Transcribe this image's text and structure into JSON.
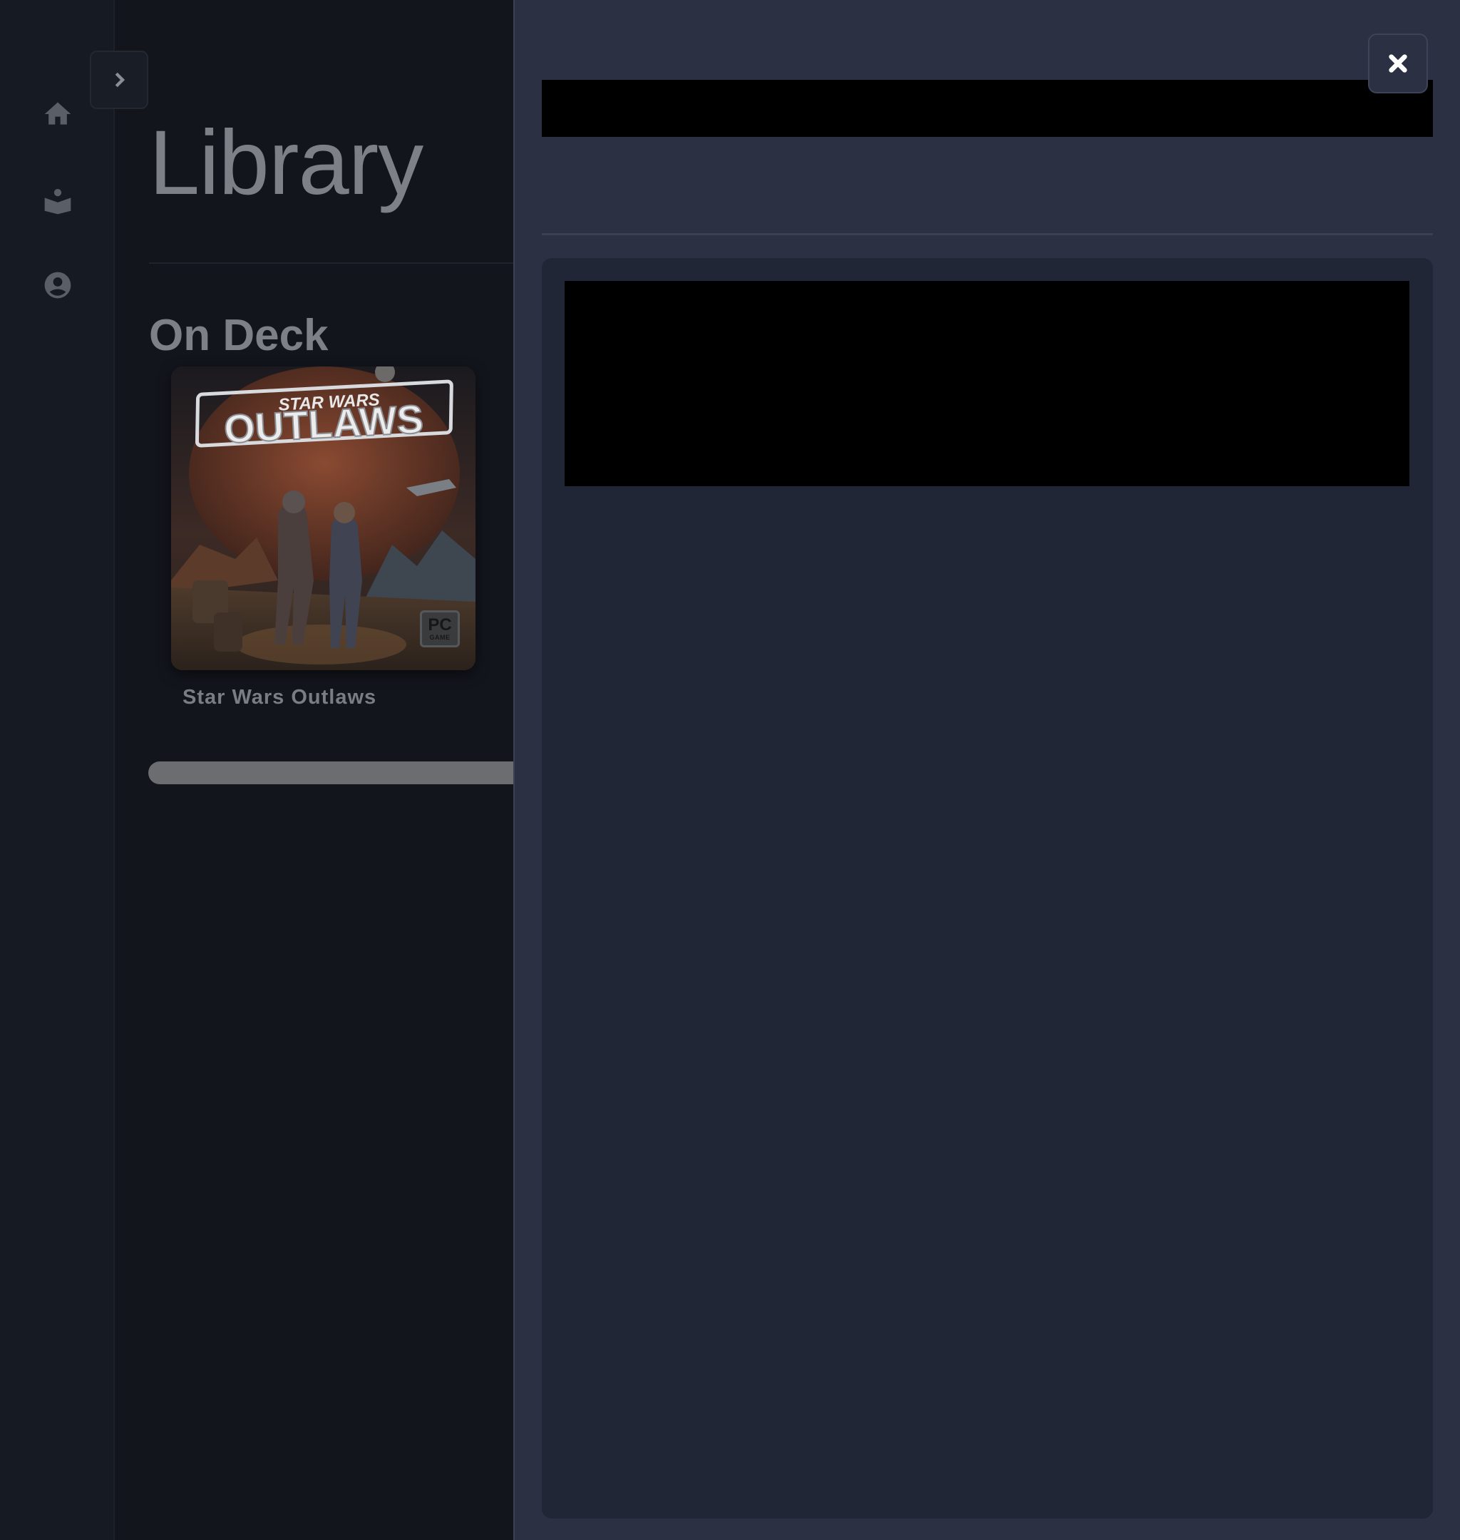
{
  "window": {
    "page_title": "Library"
  },
  "rail": {
    "items": [
      {
        "icon": "home-icon"
      },
      {
        "icon": "library-icon"
      },
      {
        "icon": "account-icon"
      }
    ],
    "expand_icon": "chevron-right-icon"
  },
  "library": {
    "section_title": "On Deck",
    "games": [
      {
        "name": "Star Wars Outlaws",
        "cover_title_top": "STAR WARS",
        "cover_title_main": "OUTLAWS",
        "badge_line1": "PC",
        "badge_line2": "GAME"
      }
    ]
  },
  "panel": {
    "close_icon": "close-icon",
    "title_redacted": true,
    "content_redacted": true
  },
  "colors": {
    "background": "#12151c",
    "panel": "#2b3042",
    "card": "#212636",
    "muted_text": "#7d8087"
  }
}
